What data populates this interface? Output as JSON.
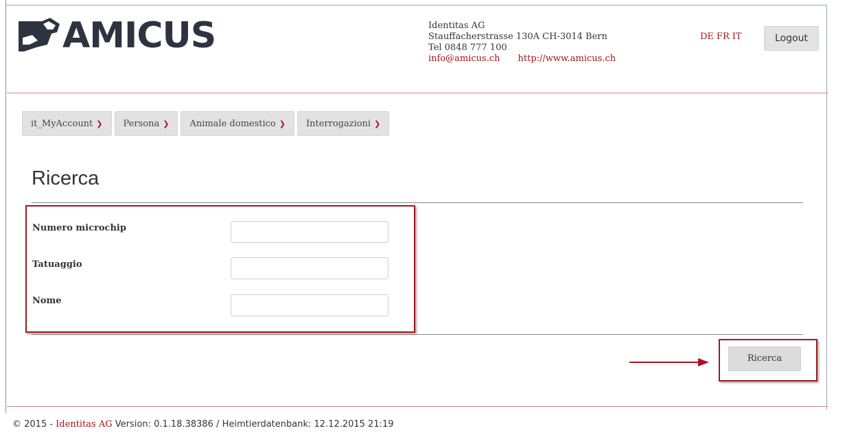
{
  "logo": {
    "text": "AMICUS",
    "icon": "dog-head-icon"
  },
  "company": {
    "name": "Identitas AG",
    "street": "Stauffacherstrasse 130A CH-3014 Bern",
    "phone": "Tel 0848 777 100",
    "email": "info@amicus.ch",
    "website": "http://www.amicus.ch"
  },
  "languages": [
    "DE",
    "FR",
    "IT"
  ],
  "logout_label": "Logout",
  "nav": [
    {
      "label": "it_MyAccount"
    },
    {
      "label": "Persona"
    },
    {
      "label": "Animale domestico"
    },
    {
      "label": "Interrogazioni"
    }
  ],
  "page_title": "Ricerca",
  "form": {
    "fields": [
      {
        "label": "Numero microchip",
        "value": ""
      },
      {
        "label": "Tatuaggio",
        "value": ""
      },
      {
        "label": "Nome",
        "value": ""
      }
    ],
    "submit_label": "Ricerca"
  },
  "footer": {
    "prefix": "© 2015 - ",
    "company": "Identitas AG",
    "version_text": " Version: 0.1.18.38386 / Heimtierdatenbank: 12.12.2015 21:19"
  },
  "colors": {
    "accent": "#a0141e",
    "highlight_border": "#9b1b20",
    "logo_dark": "#2d3440"
  }
}
